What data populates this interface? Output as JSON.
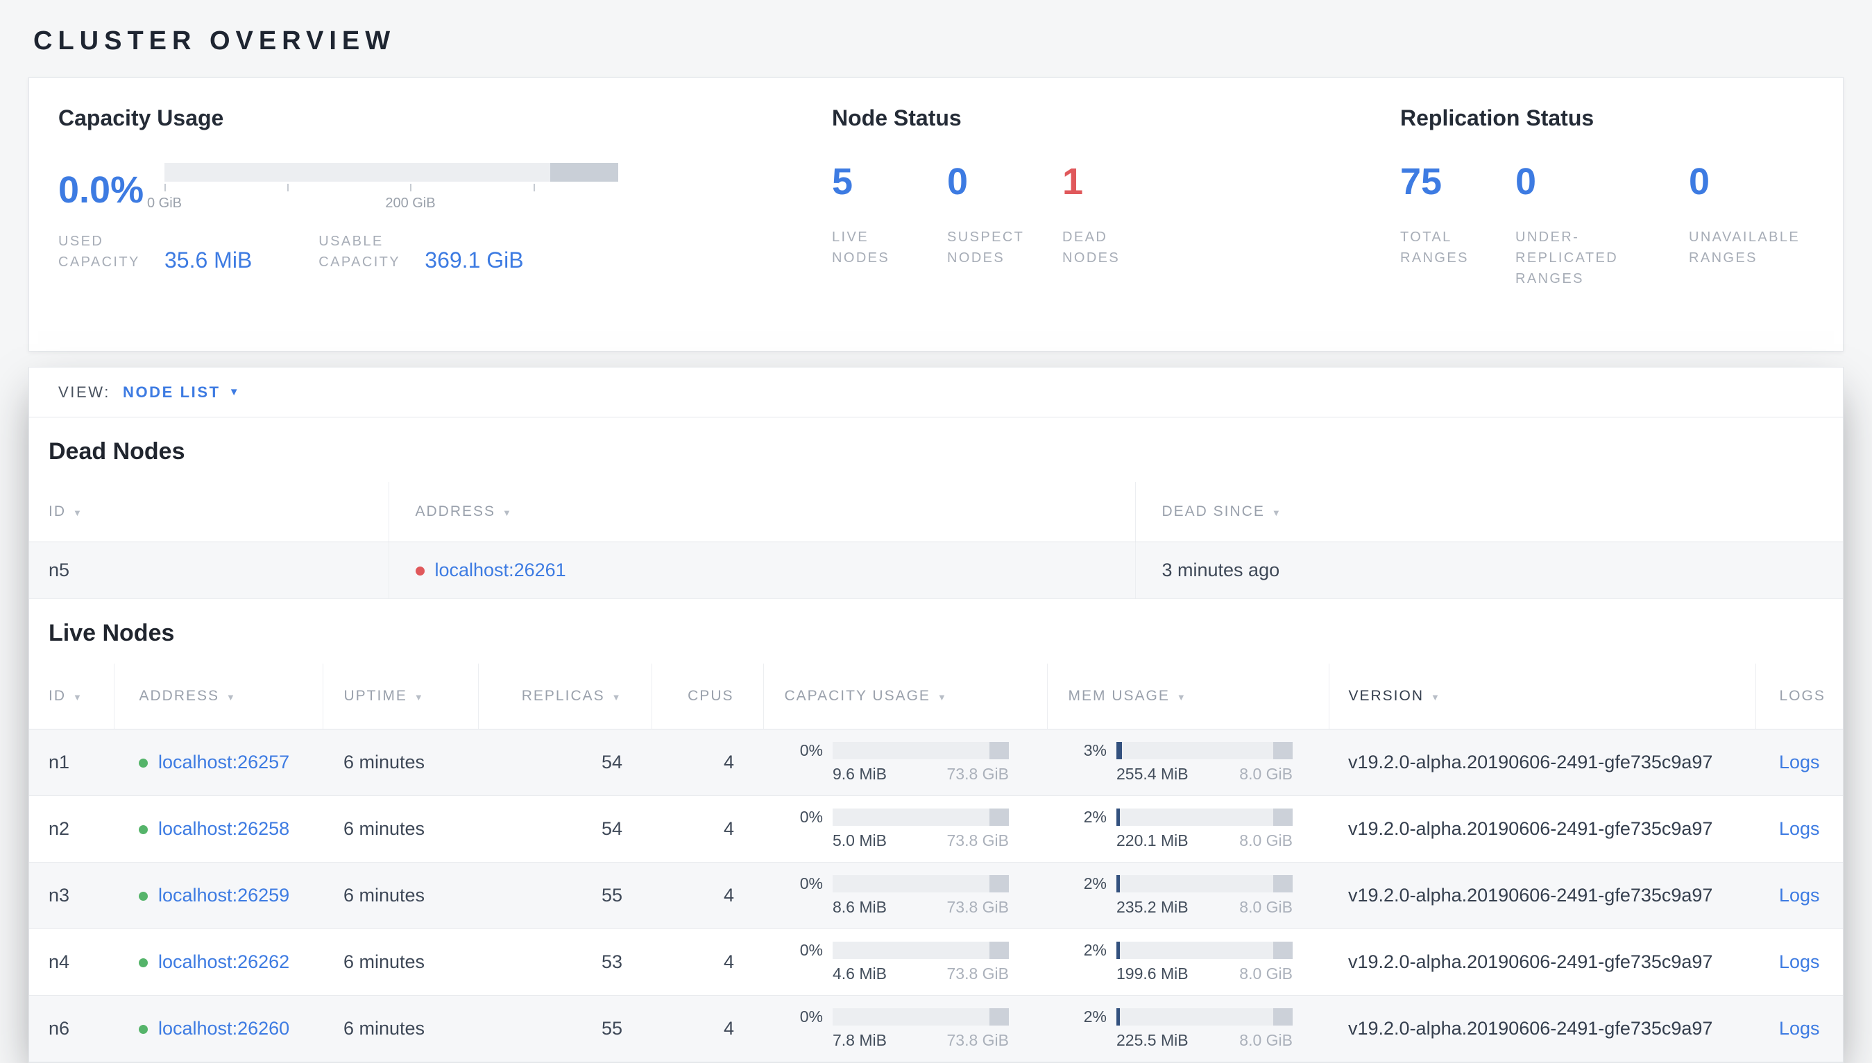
{
  "colors": {
    "accent_blue": "#3d7be2",
    "danger_red": "#e0585b",
    "live_green": "#55b46a"
  },
  "icons": {
    "sort_desc": "▼",
    "caret_down": "▼"
  },
  "page": {
    "title": "CLUSTER OVERVIEW"
  },
  "summary": {
    "capacity": {
      "title": "Capacity Usage",
      "percent": "0.0%",
      "used_fill_pct": 0,
      "axis_ticks": [
        "0 GiB",
        "200 GiB"
      ],
      "used": {
        "label": "USED CAPACITY",
        "value": "35.6 MiB"
      },
      "usable": {
        "label": "USABLE CAPACITY",
        "value": "369.1 GiB"
      }
    },
    "node_status": {
      "title": "Node Status",
      "stats": [
        {
          "value": "5",
          "label": "LIVE NODES"
        },
        {
          "value": "0",
          "label": "SUSPECT NODES"
        },
        {
          "value": "1",
          "label": "DEAD NODES"
        }
      ]
    },
    "replication": {
      "title": "Replication Status",
      "stats": [
        {
          "value": "75",
          "label": "TOTAL RANGES"
        },
        {
          "value": "0",
          "label": "UNDER-REPLICATED RANGES"
        },
        {
          "value": "0",
          "label": "UNAVAILABLE RANGES"
        }
      ]
    }
  },
  "view_bar": {
    "label": "VIEW:",
    "selected": "NODE LIST"
  },
  "dead_nodes": {
    "title": "Dead Nodes",
    "columns": [
      "ID",
      "ADDRESS",
      "DEAD SINCE"
    ],
    "rows": [
      {
        "id": "n5",
        "address": "localhost:26261",
        "dead_since": "3 minutes ago"
      }
    ]
  },
  "live_nodes": {
    "title": "Live Nodes",
    "columns": [
      "ID",
      "ADDRESS",
      "UPTIME",
      "REPLICAS",
      "CPUS",
      "CAPACITY USAGE",
      "MEM USAGE",
      "VERSION",
      "LOGS"
    ],
    "logs_label": "Logs",
    "rows": [
      {
        "id": "n1",
        "address": "localhost:26257",
        "uptime": "6 minutes",
        "replicas": "54",
        "cpus": "4",
        "capacity": {
          "percent": "0%",
          "fill_pct": 0,
          "used": "9.6 MiB",
          "total": "73.8 GiB"
        },
        "mem": {
          "percent": "3%",
          "fill_pct": 3,
          "used": "255.4 MiB",
          "total": "8.0 GiB"
        },
        "version": "v19.2.0-alpha.20190606-2491-gfe735c9a97"
      },
      {
        "id": "n2",
        "address": "localhost:26258",
        "uptime": "6 minutes",
        "replicas": "54",
        "cpus": "4",
        "capacity": {
          "percent": "0%",
          "fill_pct": 0,
          "used": "5.0 MiB",
          "total": "73.8 GiB"
        },
        "mem": {
          "percent": "2%",
          "fill_pct": 2,
          "used": "220.1 MiB",
          "total": "8.0 GiB"
        },
        "version": "v19.2.0-alpha.20190606-2491-gfe735c9a97"
      },
      {
        "id": "n3",
        "address": "localhost:26259",
        "uptime": "6 minutes",
        "replicas": "55",
        "cpus": "4",
        "capacity": {
          "percent": "0%",
          "fill_pct": 0,
          "used": "8.6 MiB",
          "total": "73.8 GiB"
        },
        "mem": {
          "percent": "2%",
          "fill_pct": 2,
          "used": "235.2 MiB",
          "total": "8.0 GiB"
        },
        "version": "v19.2.0-alpha.20190606-2491-gfe735c9a97"
      },
      {
        "id": "n4",
        "address": "localhost:26262",
        "uptime": "6 minutes",
        "replicas": "53",
        "cpus": "4",
        "capacity": {
          "percent": "0%",
          "fill_pct": 0,
          "used": "4.6 MiB",
          "total": "73.8 GiB"
        },
        "mem": {
          "percent": "2%",
          "fill_pct": 2,
          "used": "199.6 MiB",
          "total": "8.0 GiB"
        },
        "version": "v19.2.0-alpha.20190606-2491-gfe735c9a97"
      },
      {
        "id": "n6",
        "address": "localhost:26260",
        "uptime": "6 minutes",
        "replicas": "55",
        "cpus": "4",
        "capacity": {
          "percent": "0%",
          "fill_pct": 0,
          "used": "7.8 MiB",
          "total": "73.8 GiB"
        },
        "mem": {
          "percent": "2%",
          "fill_pct": 2,
          "used": "225.5 MiB",
          "total": "8.0 GiB"
        },
        "version": "v19.2.0-alpha.20190606-2491-gfe735c9a97"
      }
    ]
  }
}
